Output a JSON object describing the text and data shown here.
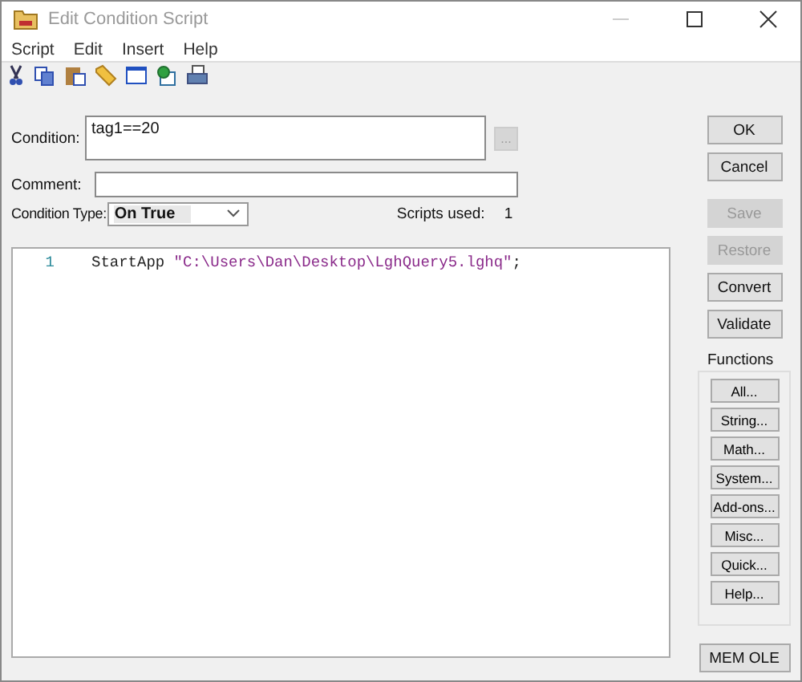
{
  "window": {
    "title": "Edit Condition Script"
  },
  "menu": [
    "Script",
    "Edit",
    "Insert",
    "Help"
  ],
  "condition": {
    "label": "Condition:",
    "value": "tag1==20",
    "browse": "...",
    "browse_disabled": true
  },
  "comment": {
    "label": "Comment:"
  },
  "condition_type": {
    "label": "Condition Type:",
    "value": "On True"
  },
  "scripts_used": {
    "label": "Scripts used:",
    "value": "1"
  },
  "editor": {
    "lines": [
      {
        "number": "1",
        "tokens": [
          {
            "kind": "keyword",
            "text": "StartApp"
          },
          {
            "kind": "string",
            "text": "\"C:\\Users\\Dan\\Desktop\\LghQuery5.lghq\""
          },
          {
            "kind": "plain",
            "text": ";"
          }
        ]
      }
    ]
  },
  "buttons": [
    {
      "label": "OK",
      "disabled": false
    },
    {
      "label": "Cancel",
      "disabled": false
    },
    {
      "label": "Save",
      "disabled": true
    },
    {
      "label": "Restore",
      "disabled": true
    },
    {
      "label": "Convert",
      "disabled": false
    },
    {
      "label": "Validate",
      "disabled": false
    }
  ],
  "functions": {
    "title": "Functions",
    "buttons": [
      "All...",
      "String...",
      "Math...",
      "System...",
      "Add-ons...",
      "Misc...",
      "Quick...",
      "Help..."
    ]
  },
  "mem_ole": "MEM OLE"
}
